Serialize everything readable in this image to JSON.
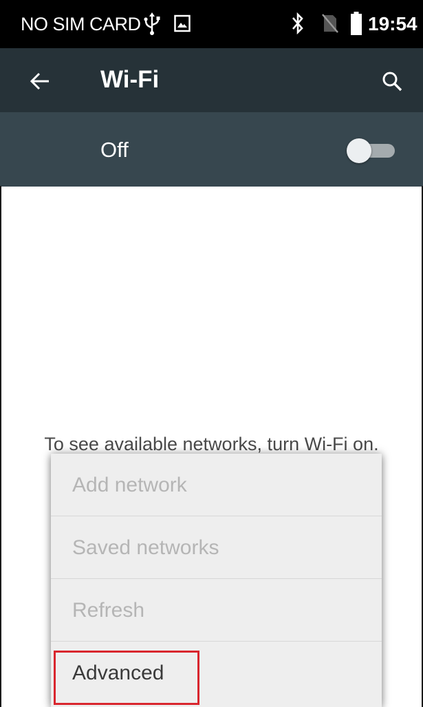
{
  "status_bar": {
    "carrier": "NO SIM CARD",
    "time": "19:54",
    "icons": [
      "usb-icon",
      "image-icon",
      "bluetooth-icon",
      "no-sim-icon",
      "battery-icon"
    ]
  },
  "toolbar": {
    "title": "Wi-Fi",
    "back_icon": "arrow-left-icon",
    "search_icon": "search-icon"
  },
  "wifi_switch": {
    "label": "Off",
    "state": "off"
  },
  "empty_state": {
    "message": "To see available networks, turn Wi-Fi on."
  },
  "overflow_menu": {
    "items": [
      {
        "label": "Add network",
        "enabled": false
      },
      {
        "label": "Saved networks",
        "enabled": false
      },
      {
        "label": "Refresh",
        "enabled": false
      },
      {
        "label": "Advanced",
        "enabled": true,
        "highlighted": true
      }
    ]
  },
  "colors": {
    "status_bar": "#000000",
    "toolbar": "#263238",
    "switch_bar": "#37474f",
    "menu_background": "#eeeeee",
    "highlight": "#d9262e"
  }
}
